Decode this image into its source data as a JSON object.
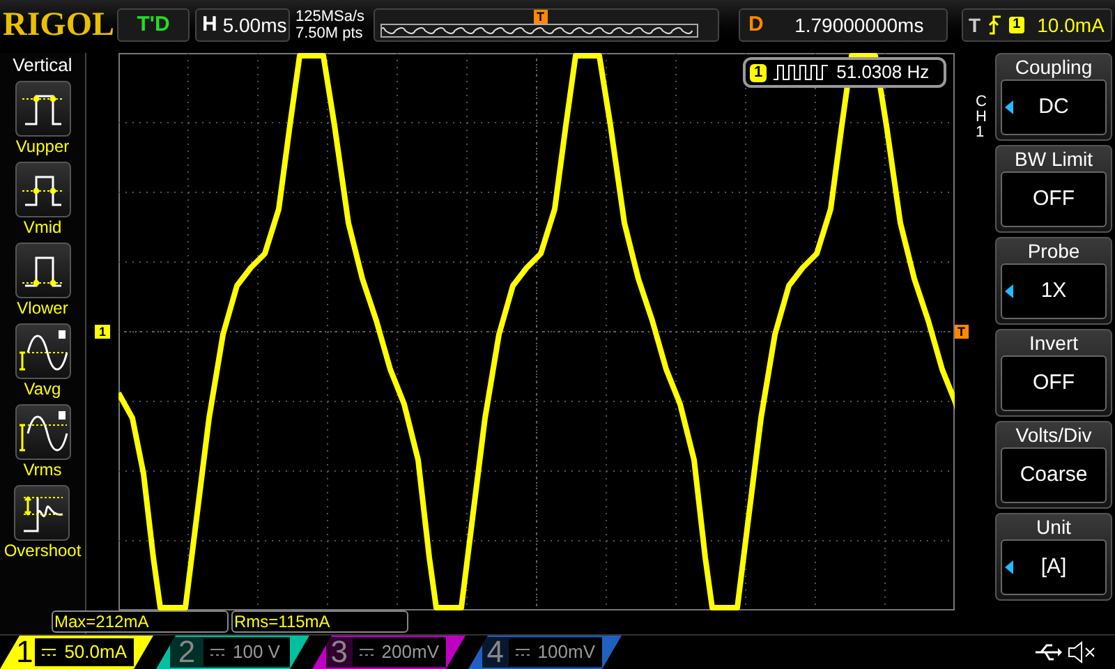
{
  "header": {
    "logo": "RIGOL",
    "run_status": "T'D",
    "horizontal": {
      "label": "H",
      "value": "5.00ms"
    },
    "sample_rate": "125MSa/s",
    "memory_depth": "7.50M pts",
    "delay": {
      "label": "D",
      "value": "1.79000000ms"
    },
    "trigger": {
      "label": "T",
      "source": "1",
      "level": "10.0mA"
    }
  },
  "left_menu": {
    "title": "Vertical",
    "items": [
      {
        "label": "Vupper",
        "kind": "vupper"
      },
      {
        "label": "Vmid",
        "kind": "vmid"
      },
      {
        "label": "Vlower",
        "kind": "vlower"
      },
      {
        "label": "Vavg",
        "kind": "vavg"
      },
      {
        "label": "Vrms",
        "kind": "vrms"
      },
      {
        "label": "Overshoot",
        "kind": "overshoot"
      }
    ]
  },
  "screen": {
    "channel_marker": "1",
    "trigger_position_marker": "T",
    "trigger_level_marker": "T",
    "frequency": {
      "channel": "1",
      "value": "51.0308 Hz"
    }
  },
  "measurements": [
    "Max=212mA",
    "Rms=115mA"
  ],
  "channels": [
    {
      "number": "1",
      "scale": "50.0mA",
      "selected": true,
      "color": "#ffff00"
    },
    {
      "number": "2",
      "scale": "100 V",
      "selected": false,
      "color": "#00c0a0"
    },
    {
      "number": "3",
      "scale": "200mV",
      "selected": false,
      "color": "#c000c0"
    },
    {
      "number": "4",
      "scale": "100mV",
      "selected": false,
      "color": "#2060c0"
    }
  ],
  "right_menu": {
    "channel": "CH1",
    "items": [
      {
        "title": "Coupling",
        "value": "DC",
        "adjustable": true
      },
      {
        "title": "BW Limit",
        "value": "OFF",
        "adjustable": false
      },
      {
        "title": "Probe",
        "value": "1X",
        "adjustable": true
      },
      {
        "title": "Invert",
        "value": "OFF",
        "adjustable": false
      },
      {
        "title": "Volts/Div",
        "value": "Coarse",
        "adjustable": false
      },
      {
        "title": "Unit",
        "value": "[A]",
        "adjustable": true
      }
    ]
  }
}
